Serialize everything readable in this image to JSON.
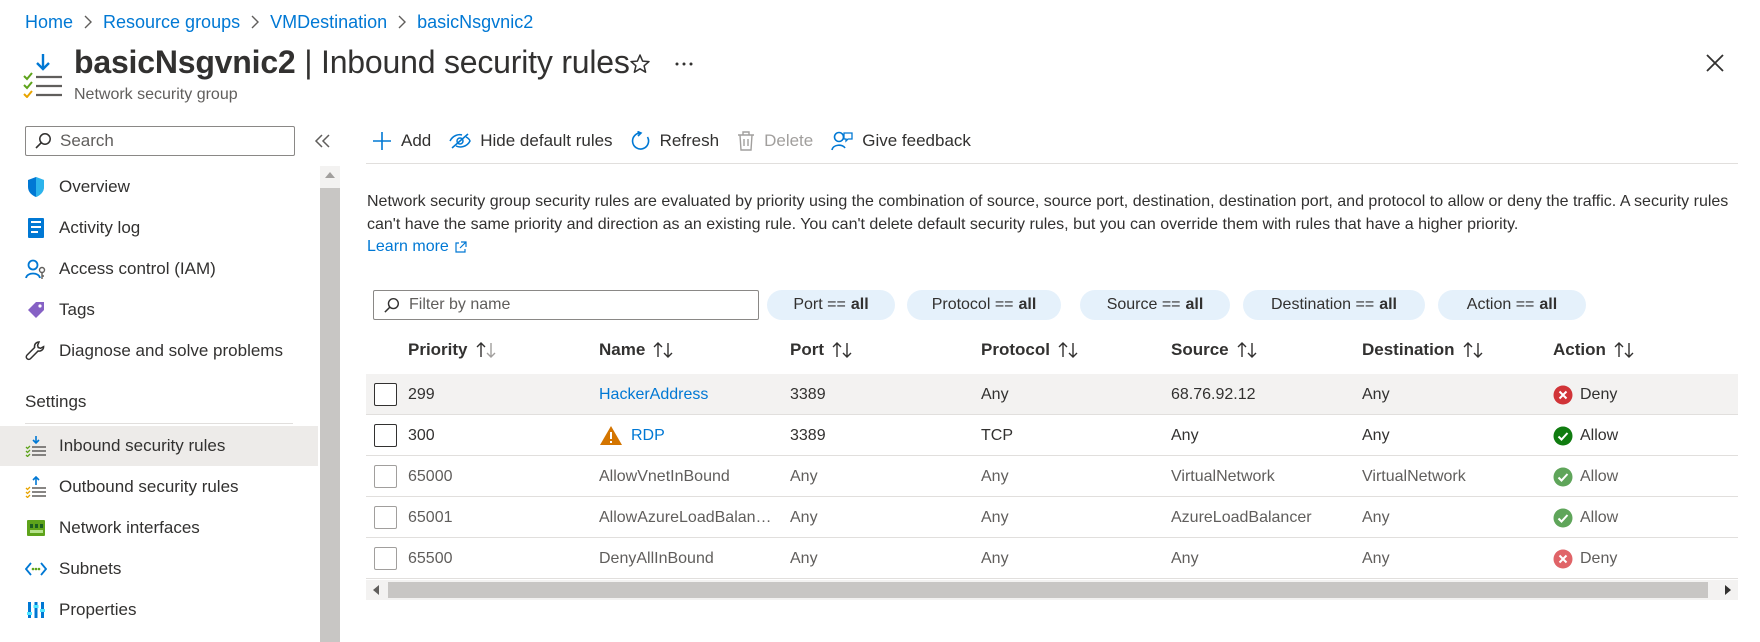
{
  "breadcrumb": [
    "Home",
    "Resource groups",
    "VMDestination",
    "basicNsgvnic2"
  ],
  "header": {
    "resource_name": "basicNsgvnic2",
    "separator": " | ",
    "blade_title": "Inbound security rules",
    "subtitle": "Network security group"
  },
  "sidebar": {
    "search_placeholder": "Search",
    "items_top": [
      {
        "label": "Overview",
        "icon": "shield-icon"
      },
      {
        "label": "Activity log",
        "icon": "log-icon"
      },
      {
        "label": "Access control (IAM)",
        "icon": "iam-icon"
      },
      {
        "label": "Tags",
        "icon": "tag-icon"
      },
      {
        "label": "Diagnose and solve problems",
        "icon": "wrench-icon"
      }
    ],
    "section_label": "Settings",
    "items_settings": [
      {
        "label": "Inbound security rules",
        "icon": "inbound-icon",
        "active": true
      },
      {
        "label": "Outbound security rules",
        "icon": "outbound-icon"
      },
      {
        "label": "Network interfaces",
        "icon": "nic-icon"
      },
      {
        "label": "Subnets",
        "icon": "subnet-icon"
      },
      {
        "label": "Properties",
        "icon": "properties-icon"
      }
    ]
  },
  "toolbar": {
    "add": "Add",
    "hide_default": "Hide default rules",
    "refresh": "Refresh",
    "delete": "Delete",
    "feedback": "Give feedback"
  },
  "description": {
    "text": "Network security group security rules are evaluated by priority using the combination of source, source port, destination, destination port, and protocol to allow or deny the traffic. A security rules can't have the same priority and direction as an existing rule. You can't delete default security rules, but you can override them with rules that have a higher priority.",
    "learn_more": "Learn more"
  },
  "filter": {
    "placeholder": "Filter by name",
    "pills": [
      {
        "key": "Port ==",
        "value": "all"
      },
      {
        "key": "Protocol ==",
        "value": "all"
      },
      {
        "key": "Source ==",
        "value": "all"
      },
      {
        "key": "Destination ==",
        "value": "all"
      },
      {
        "key": "Action ==",
        "value": "all"
      }
    ]
  },
  "table": {
    "columns": [
      "Priority",
      "Name",
      "Port",
      "Protocol",
      "Source",
      "Destination",
      "Action"
    ],
    "rows": [
      {
        "priority": "299",
        "name": "HackerAddress",
        "port": "3389",
        "protocol": "Any",
        "source": "68.76.92.12",
        "destination": "Any",
        "action": "Deny",
        "custom": true,
        "warning": false
      },
      {
        "priority": "300",
        "name": "RDP",
        "port": "3389",
        "protocol": "TCP",
        "source": "Any",
        "destination": "Any",
        "action": "Allow",
        "custom": true,
        "warning": true
      },
      {
        "priority": "65000",
        "name": "AllowVnetInBound",
        "port": "Any",
        "protocol": "Any",
        "source": "VirtualNetwork",
        "destination": "VirtualNetwork",
        "action": "Allow",
        "custom": false,
        "warning": false
      },
      {
        "priority": "65001",
        "name": "AllowAzureLoadBalan…",
        "port": "Any",
        "protocol": "Any",
        "source": "AzureLoadBalancer",
        "destination": "Any",
        "action": "Allow",
        "custom": false,
        "warning": false
      },
      {
        "priority": "65500",
        "name": "DenyAllInBound",
        "port": "Any",
        "protocol": "Any",
        "source": "Any",
        "destination": "Any",
        "action": "Deny",
        "custom": false,
        "warning": false
      }
    ]
  },
  "colors": {
    "link": "#0078d4",
    "allow": "#107c10",
    "deny": "#d13438",
    "warning": "#d47500",
    "pill_bg": "#e5f1fb",
    "active_nav_bg": "#edebe9"
  }
}
